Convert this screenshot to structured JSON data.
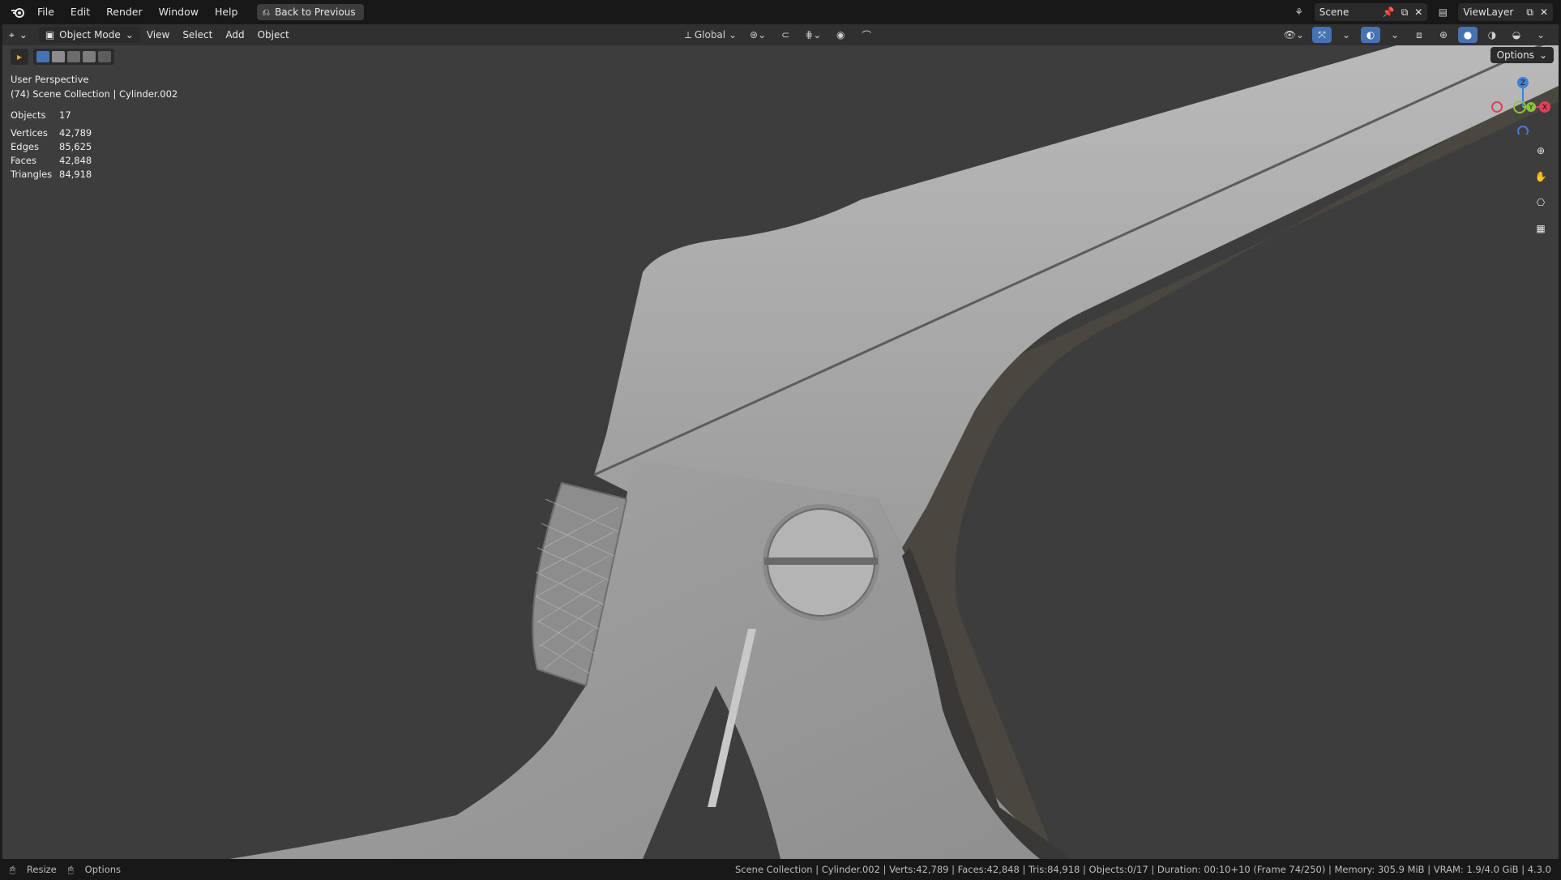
{
  "menubar": {
    "items": [
      "File",
      "Edit",
      "Render",
      "Window",
      "Help"
    ],
    "back_button": "Back to Previous",
    "scene_name": "Scene",
    "view_layer": "ViewLayer"
  },
  "viewport_header": {
    "mode": "Object Mode",
    "menus": [
      "View",
      "Select",
      "Add",
      "Object"
    ],
    "orientation": "Global",
    "options": "Options"
  },
  "overlay": {
    "view_name": "User Perspective",
    "collection": "(74) Scene Collection | Cylinder.002"
  },
  "stats": [
    {
      "label": "Objects",
      "value": "17"
    },
    {
      "label": "Vertices",
      "value": "42,789"
    },
    {
      "label": "Edges",
      "value": "85,625"
    },
    {
      "label": "Faces",
      "value": "42,848"
    },
    {
      "label": "Triangles",
      "value": "84,918"
    }
  ],
  "gizmo": {
    "z": "Z",
    "x": "X",
    "y": "Y"
  },
  "statusbar": {
    "resize": "Resize",
    "options": "Options",
    "info": "Scene Collection | Cylinder.002 | Verts:42,789 | Faces:42,848 | Tris:84,918 | Objects:0/17 | Duration: 00:10+10 (Frame 74/250) | Memory: 305.9 MiB | VRAM: 1.9/4.0 GiB | 4.3.0"
  },
  "colors": {
    "accent": "#4772b3",
    "viewport_bg": "#3d3d3d",
    "axis_x": "#e0405a",
    "axis_y": "#8bc53f",
    "axis_z": "#3f7fe0"
  }
}
